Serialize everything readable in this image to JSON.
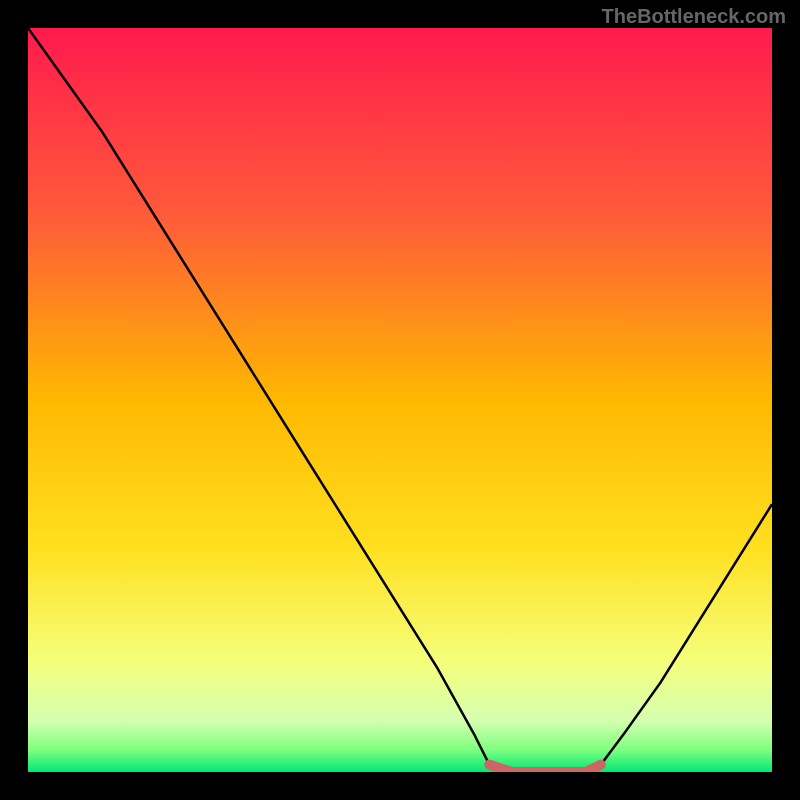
{
  "watermark": "TheBottleneck.com",
  "chart_data": {
    "type": "line",
    "title": "",
    "xlabel": "",
    "ylabel": "",
    "x": [
      0,
      5,
      10,
      15,
      20,
      25,
      30,
      35,
      40,
      45,
      50,
      55,
      60,
      62,
      65,
      70,
      75,
      77,
      80,
      85,
      90,
      95,
      100
    ],
    "values": [
      100,
      93,
      86,
      78,
      70,
      62,
      54,
      46,
      38,
      30,
      22,
      14,
      5,
      1,
      0,
      0,
      0,
      1,
      5,
      12,
      20,
      28,
      36
    ],
    "xlim": [
      0,
      100
    ],
    "ylim": [
      0,
      100
    ],
    "highlight_segment": {
      "x": [
        62,
        65,
        70,
        75,
        77
      ],
      "values": [
        1,
        0,
        0,
        0,
        1
      ],
      "color": "#cc6666"
    },
    "background_gradient": {
      "stops": [
        {
          "offset": 0,
          "color": "#ff1a4d"
        },
        {
          "offset": 25,
          "color": "#ff5a3a"
        },
        {
          "offset": 50,
          "color": "#ffb800"
        },
        {
          "offset": 70,
          "color": "#ffe020"
        },
        {
          "offset": 85,
          "color": "#f5ff7a"
        },
        {
          "offset": 93,
          "color": "#d5ffb0"
        },
        {
          "offset": 97,
          "color": "#80ff80"
        },
        {
          "offset": 100,
          "color": "#00e676"
        }
      ]
    }
  }
}
